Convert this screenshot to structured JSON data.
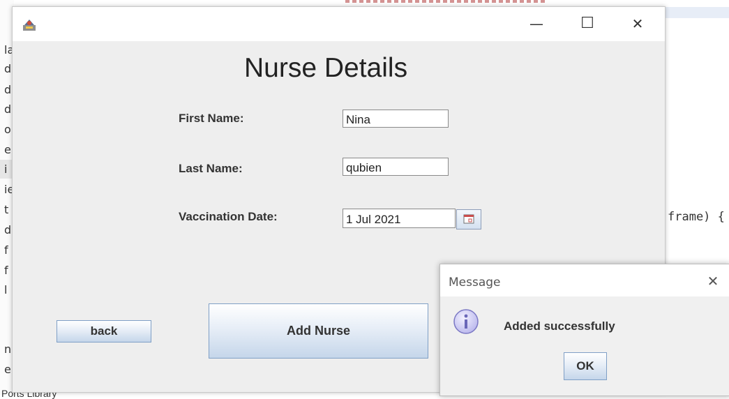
{
  "background_editor": {
    "gutter_letters": [
      "la",
      "d",
      "d",
      "d",
      "o",
      "e",
      "i",
      "ie",
      "t",
      "d",
      "f",
      "f",
      "l",
      "n",
      "e"
    ],
    "code_snippet": "frame) {",
    "footer_text": "Ports Library"
  },
  "window": {
    "minimize_glyph": "—",
    "maximize_glyph": "☐",
    "close_glyph": "✕",
    "icon": "java-app-icon"
  },
  "form": {
    "title": "Nurse Details",
    "first_name_label": "First Name:",
    "first_name_value": "Nina",
    "last_name_label": "Last Name:",
    "last_name_value": "qubien",
    "vaccination_date_label": "Vaccination Date:",
    "vaccination_date_value": "1 Jul 2021",
    "calendar_icon": "calendar-icon",
    "back_label": "back",
    "add_nurse_label": "Add Nurse"
  },
  "dialog": {
    "title": "Message",
    "close_glyph": "✕",
    "icon": "info-icon",
    "message": "Added successfully",
    "ok_label": "OK"
  },
  "colors": {
    "window_bg": "#eeeeee",
    "button_border": "#7f9fc6",
    "info_icon": "#7b78c4"
  }
}
